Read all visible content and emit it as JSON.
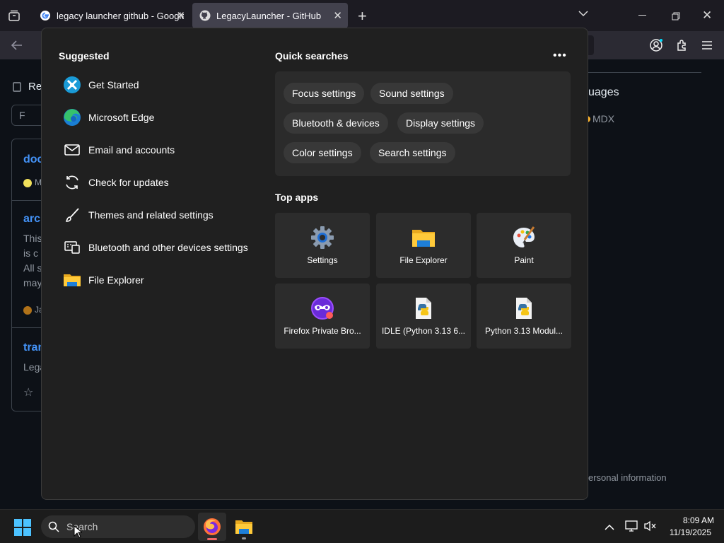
{
  "browser": {
    "tabs": [
      {
        "label": "legacy launcher github - Google",
        "icon": "google-icon"
      },
      {
        "label": "LegacyLauncher - GitHub",
        "icon": "github-icon"
      }
    ]
  },
  "background_page": {
    "fragments": [
      "Re",
      "F",
      "doc",
      "M",
      "arcl",
      "This",
      "is c",
      "All s",
      "may",
      "Ja",
      "tran",
      "Lega",
      "uages",
      "MDX",
      "ersonal information"
    ]
  },
  "start_menu": {
    "suggested": {
      "heading": "Suggested",
      "items": [
        {
          "label": "Get Started",
          "icon": "get-started-icon"
        },
        {
          "label": "Microsoft Edge",
          "icon": "edge-icon"
        },
        {
          "label": "Email and accounts",
          "icon": "mail-icon"
        },
        {
          "label": "Check for updates",
          "icon": "refresh-icon"
        },
        {
          "label": "Themes and related settings",
          "icon": "brush-icon"
        },
        {
          "label": "Bluetooth and other devices settings",
          "icon": "devices-icon"
        },
        {
          "label": "File Explorer",
          "icon": "folder-icon"
        }
      ]
    },
    "quick_searches": {
      "heading": "Quick searches",
      "more_icon": "more-icon",
      "chips": [
        "Focus settings",
        "Sound settings",
        "Bluetooth & devices",
        "Display settings",
        "Color settings",
        "Search settings"
      ]
    },
    "top_apps": {
      "heading": "Top apps",
      "apps": [
        {
          "label": "Settings",
          "icon": "settings-gear-icon"
        },
        {
          "label": "File Explorer",
          "icon": "folder-icon"
        },
        {
          "label": "Paint",
          "icon": "paint-palette-icon"
        },
        {
          "label": "Firefox Private Bro...",
          "icon": "firefox-private-icon"
        },
        {
          "label": "IDLE (Python 3.13 6...",
          "icon": "python-icon"
        },
        {
          "label": "Python 3.13 Modul...",
          "icon": "python-icon"
        }
      ]
    }
  },
  "taskbar": {
    "search_placeholder": "Search",
    "time": "8:09 AM",
    "date": "11/19/2025"
  }
}
